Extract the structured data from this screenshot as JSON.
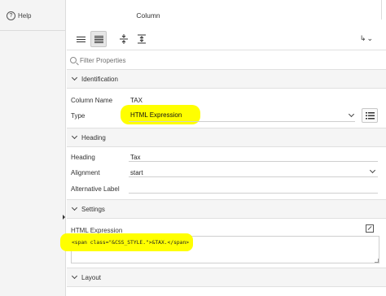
{
  "sidebar": {
    "help_label": "Help",
    "help_icon": "?"
  },
  "panel": {
    "title": "Column"
  },
  "toolbar": {
    "menu_icon": "↳",
    "menu_caret": "⌄"
  },
  "filter": {
    "placeholder": "Filter Properties"
  },
  "sections": {
    "identification": "Identification",
    "heading": "Heading",
    "settings": "Settings",
    "layout": "Layout"
  },
  "properties": {
    "column_name": {
      "label": "Column Name",
      "value": "TAX"
    },
    "type": {
      "label": "Type",
      "value": "HTML Expression"
    },
    "heading": {
      "label": "Heading",
      "value": "Tax"
    },
    "alignment": {
      "label": "Alignment",
      "value": "start"
    },
    "alternative_label": {
      "label": "Alternative Label",
      "value": ""
    },
    "html_expression": {
      "label": "HTML Expression",
      "value": "<span class=\"&CSS_STYLE.\">&TAX.</span>"
    }
  },
  "colors": {
    "highlight": "#ffff00",
    "section_bg": "#f5f5f5"
  }
}
